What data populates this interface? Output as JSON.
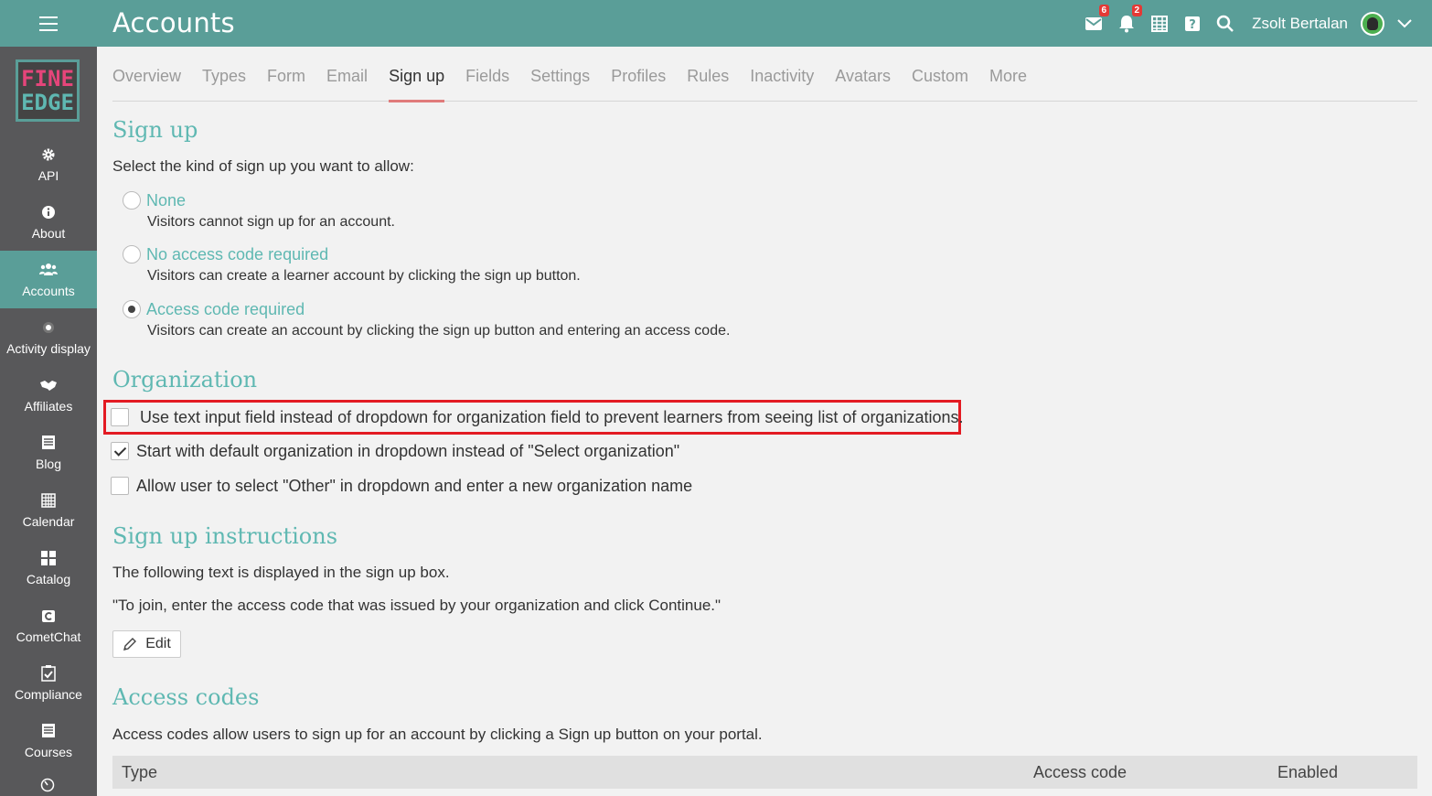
{
  "header": {
    "title": "Accounts",
    "mail_badge": "6",
    "notification_badge": "2",
    "user_name": "Zsolt Bertalan"
  },
  "logo": {
    "line1": "FINE",
    "line2": "EDGE"
  },
  "sidebar": {
    "items": [
      {
        "label": "API",
        "icon": "gear-icon"
      },
      {
        "label": "About",
        "icon": "info-icon"
      },
      {
        "label": "Accounts",
        "icon": "users-icon"
      },
      {
        "label": "Activity display",
        "icon": "dot-icon"
      },
      {
        "label": "Affiliates",
        "icon": "handshake-icon"
      },
      {
        "label": "Blog",
        "icon": "blog-icon"
      },
      {
        "label": "Calendar",
        "icon": "calendar-icon"
      },
      {
        "label": "Catalog",
        "icon": "grid-icon"
      },
      {
        "label": "CometChat",
        "icon": "chat-icon"
      },
      {
        "label": "Compliance",
        "icon": "clipboard-check-icon"
      },
      {
        "label": "Courses",
        "icon": "courses-icon"
      }
    ],
    "active": "Accounts"
  },
  "tabs": [
    "Overview",
    "Types",
    "Form",
    "Email",
    "Sign up",
    "Fields",
    "Settings",
    "Profiles",
    "Rules",
    "Inactivity",
    "Avatars",
    "Custom",
    "More"
  ],
  "active_tab": "Sign up",
  "signup": {
    "title": "Sign up",
    "intro": "Select the kind of sign up you want to allow:",
    "options": [
      {
        "label": "None",
        "desc": "Visitors cannot sign up for an account.",
        "selected": false
      },
      {
        "label": "No access code required",
        "desc": "Visitors can create a learner account by clicking the sign up button.",
        "selected": false
      },
      {
        "label": "Access code required",
        "desc": "Visitors can create an account by clicking the sign up button and entering an access code.",
        "selected": true
      }
    ]
  },
  "organization": {
    "title": "Organization",
    "checkboxes": [
      {
        "label": "Use text input field instead of dropdown for organization field to prevent learners from seeing list of organizations.",
        "checked": false
      },
      {
        "label": "Start with default organization in dropdown instead of \"Select organization\"",
        "checked": true
      },
      {
        "label": "Allow user to select \"Other\" in dropdown and enter a new organization name",
        "checked": false
      }
    ]
  },
  "instructions": {
    "title": "Sign up instructions",
    "intro": "The following text is displayed in the sign up box.",
    "quote": "\"To join, enter the access code that was issued by your organization and click Continue.\"",
    "edit_label": "Edit"
  },
  "access_codes": {
    "title": "Access codes",
    "intro": "Access codes allow users to sign up for an account by clicking a Sign up button on your portal.",
    "columns": [
      "Type",
      "Access code",
      "Enabled"
    ]
  },
  "colors": {
    "teal": "#5a9e98",
    "accent_text": "#5fb8b2",
    "sidebar": "#58585a",
    "highlight": "#e31b23"
  }
}
